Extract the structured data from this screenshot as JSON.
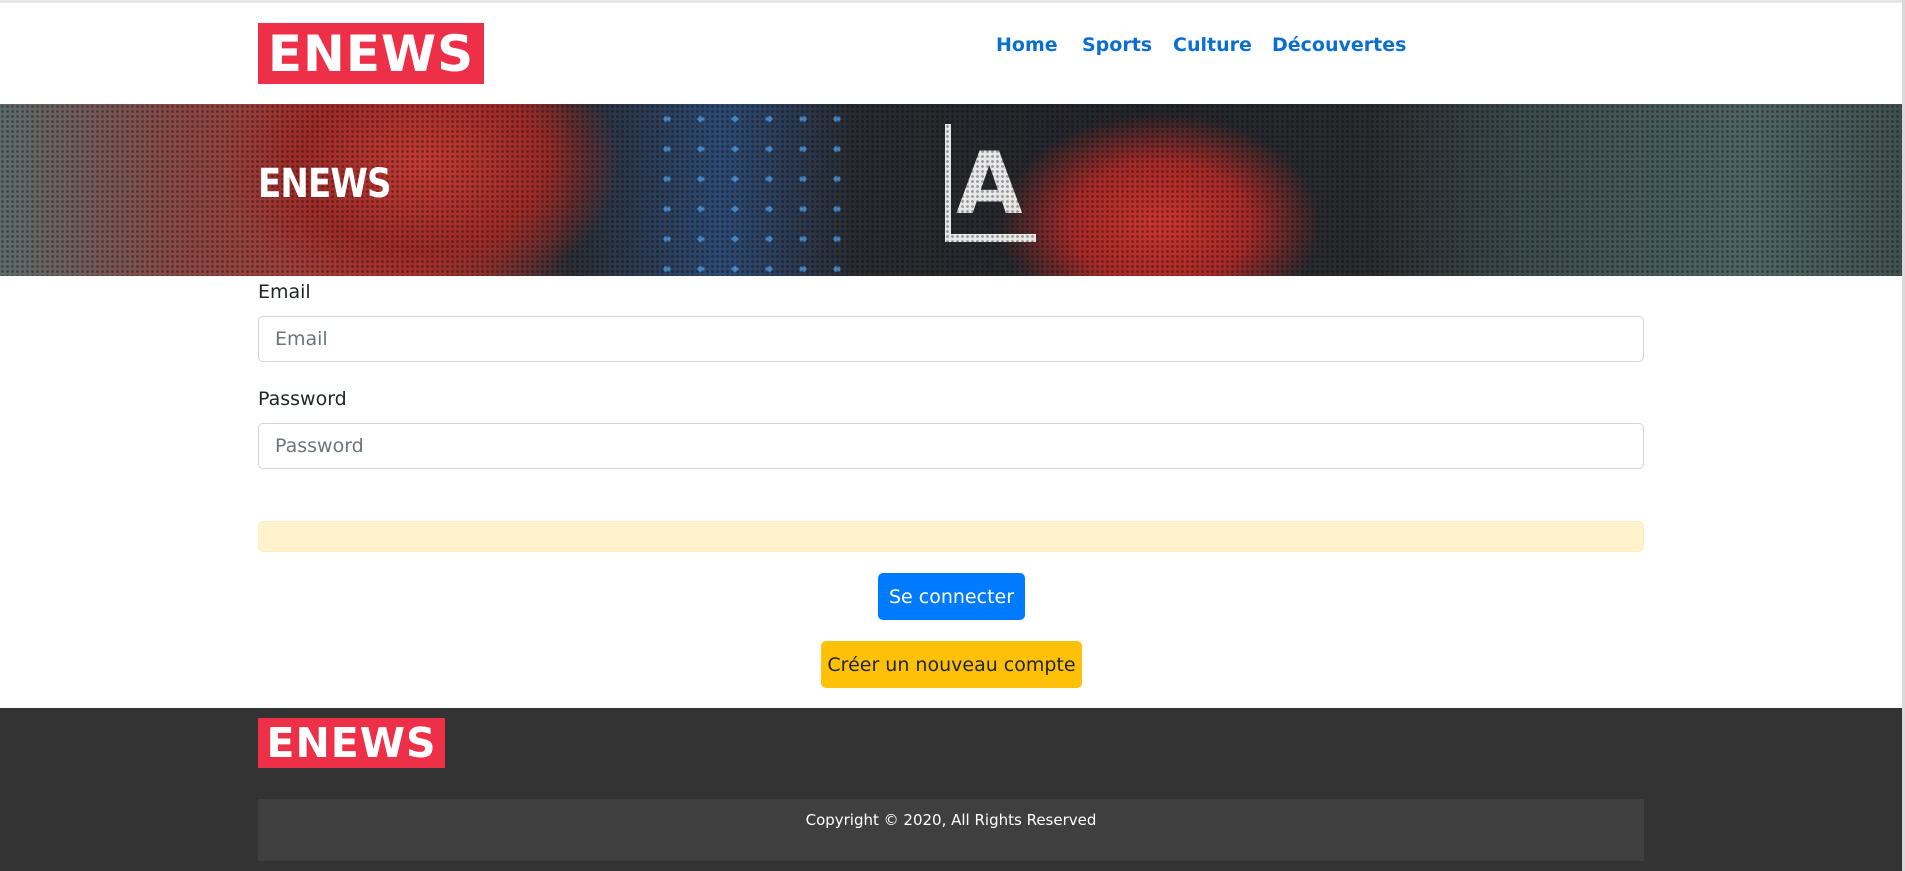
{
  "header": {
    "logo_text": "ENEWS",
    "nav": [
      {
        "label": "Home"
      },
      {
        "label": "Sports"
      },
      {
        "label": "Culture"
      },
      {
        "label": "Découvertes"
      }
    ]
  },
  "hero": {
    "title": "ENEWS",
    "sign_letter": "A"
  },
  "form": {
    "email_label": "Email",
    "email_placeholder": "Email",
    "email_value": "",
    "password_label": "Password",
    "password_placeholder": "Password",
    "password_value": "",
    "alert_text": "",
    "login_button": "Se connecter",
    "register_button": "Créer un nouveau compte"
  },
  "footer": {
    "logo_text": "ENEWS",
    "copyright": "Copyright © 2020, All Rights Reserved"
  },
  "colors": {
    "brand_red": "#ed2f48",
    "link_blue": "#0a6fd1",
    "primary": "#007bff",
    "warning": "#ffc107",
    "alert_bg": "#fff3cd",
    "footer_bg": "#333333"
  }
}
